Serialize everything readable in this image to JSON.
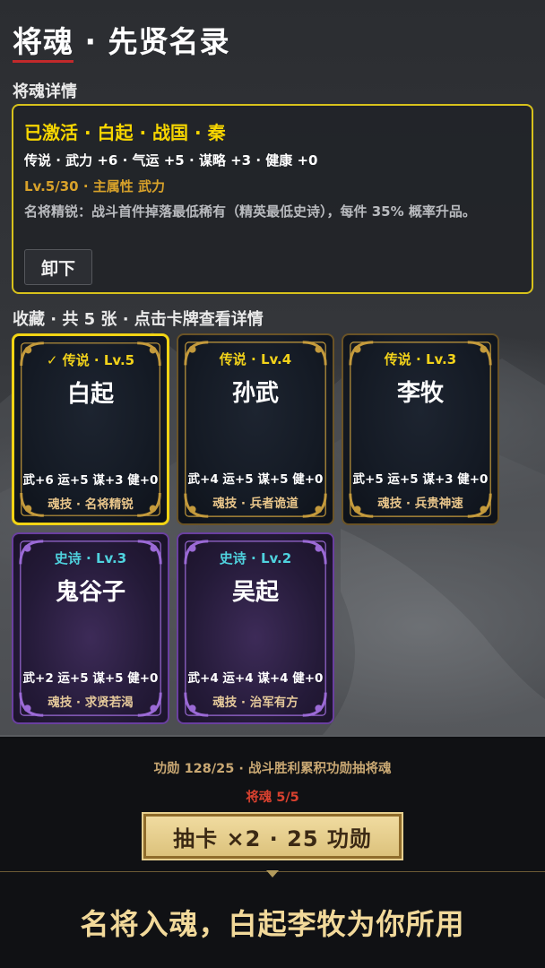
{
  "title": "将魂 · 先贤名录",
  "detail_section_label": "将魂详情",
  "detail": {
    "status": "已激活 · 白起 · 战国 · 秦",
    "stats": "传说 · 武力 +6 · 气运 +5 · 谋略 +3 · 健康 +0",
    "level_line": "Lv.5/30 · 主属性 武力",
    "description": "名将精锐：战斗首件掉落最低稀有（精英最低史诗），每件 35% 概率升品。",
    "unload_label": "卸下"
  },
  "collection_label": "收藏 · 共 5 张 · 点击卡牌查看详情",
  "cards": [
    {
      "tier": "✓ 传说 · Lv.5",
      "name": "白起",
      "stats": "武+6 运+5 谋+3 健+0",
      "skill": "魂技 · 名将精锐",
      "rarity": "legend",
      "selected": true
    },
    {
      "tier": "传说 · Lv.4",
      "name": "孙武",
      "stats": "武+4 运+5 谋+5 健+0",
      "skill": "魂技 · 兵者诡道",
      "rarity": "legend",
      "selected": false
    },
    {
      "tier": "传说 · Lv.3",
      "name": "李牧",
      "stats": "武+5 运+5 谋+3 健+0",
      "skill": "魂技 · 兵贵神速",
      "rarity": "legend",
      "selected": false
    },
    {
      "tier": "史诗 · Lv.3",
      "name": "鬼谷子",
      "stats": "武+2 运+5 谋+5 健+0",
      "skill": "魂技 · 求贤若渴",
      "rarity": "epic",
      "selected": false
    },
    {
      "tier": "史诗 · Lv.2",
      "name": "吴起",
      "stats": "武+4 运+4 谋+4 健+0",
      "skill": "魂技 · 治军有方",
      "rarity": "epic",
      "selected": false
    }
  ],
  "merit_line": "功勋 128/25 · 战斗胜利累积功勋抽将魂",
  "soul_count": "将魂 5/5",
  "draw_button": "抽卡 ×2 · 25 功勋",
  "slogan": "名将入魂，白起李牧为你所用",
  "colors": {
    "accent_gold": "#f7d600",
    "legend_tier": "#f2d21a",
    "epic_tier": "#4fd2de",
    "title_underline": "#c2292b",
    "soul_count": "#d9412f"
  }
}
